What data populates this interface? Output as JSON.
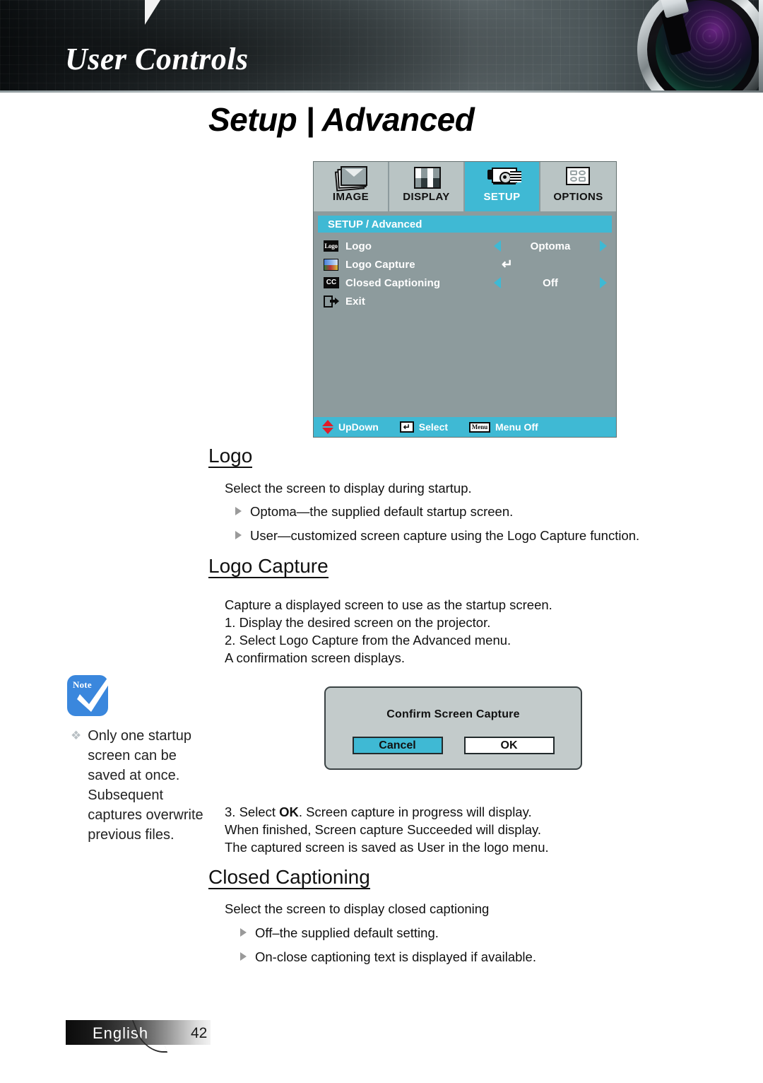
{
  "header": {
    "banner_title": "User Controls",
    "lens_icon": "camera-lens-icon"
  },
  "page_heading": "Setup | Advanced",
  "osd": {
    "tabs": [
      {
        "label": "IMAGE",
        "icon": "image-stack-icon",
        "active": false
      },
      {
        "label": "DISPLAY",
        "icon": "display-grid-icon",
        "active": false
      },
      {
        "label": "SETUP",
        "icon": "projector-icon",
        "active": true
      },
      {
        "label": "OPTIONS",
        "icon": "options-grid-icon",
        "active": false
      }
    ],
    "section_title": "SETUP / Advanced",
    "items": [
      {
        "icon": "logo-icon",
        "label": "Logo",
        "value": "Optoma",
        "control": "arrows"
      },
      {
        "icon": "logo-capture-icon",
        "label": "Logo Capture",
        "value": "",
        "control": "enter"
      },
      {
        "icon": "closed-caption-icon",
        "label": "Closed Captioning",
        "value": "Off",
        "control": "arrows"
      },
      {
        "icon": "exit-icon",
        "label": "Exit",
        "value": "",
        "control": "none"
      }
    ],
    "footer": [
      {
        "key_glyph": "up-down-arrows-icon",
        "label": "UpDown",
        "key_text": ""
      },
      {
        "key_glyph": "enter-key-icon",
        "label": "Select",
        "key_text": "↵"
      },
      {
        "key_glyph": "menu-key-icon",
        "label": "Menu Off",
        "key_text": "Menu"
      }
    ],
    "colors": {
      "accent": "#3fb9d4",
      "panel": "#8d9b9d",
      "tab": "#b9c4c4"
    }
  },
  "sections": {
    "logo": {
      "title": "Logo",
      "intro": "Select the screen to display during startup.",
      "bullets": [
        "Optoma—the supplied default startup screen.",
        "User—customized screen capture using the Logo Capture function."
      ]
    },
    "logo_capture": {
      "title": "Logo Capture",
      "intro": "Capture a displayed screen to use as the startup screen.",
      "steps_before": "1. Display the desired screen on the projector.\n2. Select Logo Capture from the Advanced menu.\n    A confirmation screen displays.",
      "step3_prefix": "3. Select ",
      "step3_bold": "OK",
      "step3_suffix": ". Screen capture in progress will display.",
      "step3_lines": "    When finished, Screen capture Succeeded will display.\n    The captured screen is saved as User in the logo menu."
    },
    "closed_captioning": {
      "title": "Closed Captioning",
      "intro": "Select the screen to display closed captioning",
      "bullets": [
        "Off–the supplied default setting.",
        "On-close captioning text is displayed if available."
      ]
    }
  },
  "confirm_dialog": {
    "title": "Confirm Screen Capture",
    "cancel_label": "Cancel",
    "ok_label": "OK"
  },
  "note": {
    "badge_text": "Note",
    "badge_icon": "check-mark-icon",
    "bullet": "❖",
    "text": "Only one startup screen can be saved at once. Subsequent captures overwrite previous files."
  },
  "footer": {
    "language": "English",
    "page_number": "42"
  }
}
